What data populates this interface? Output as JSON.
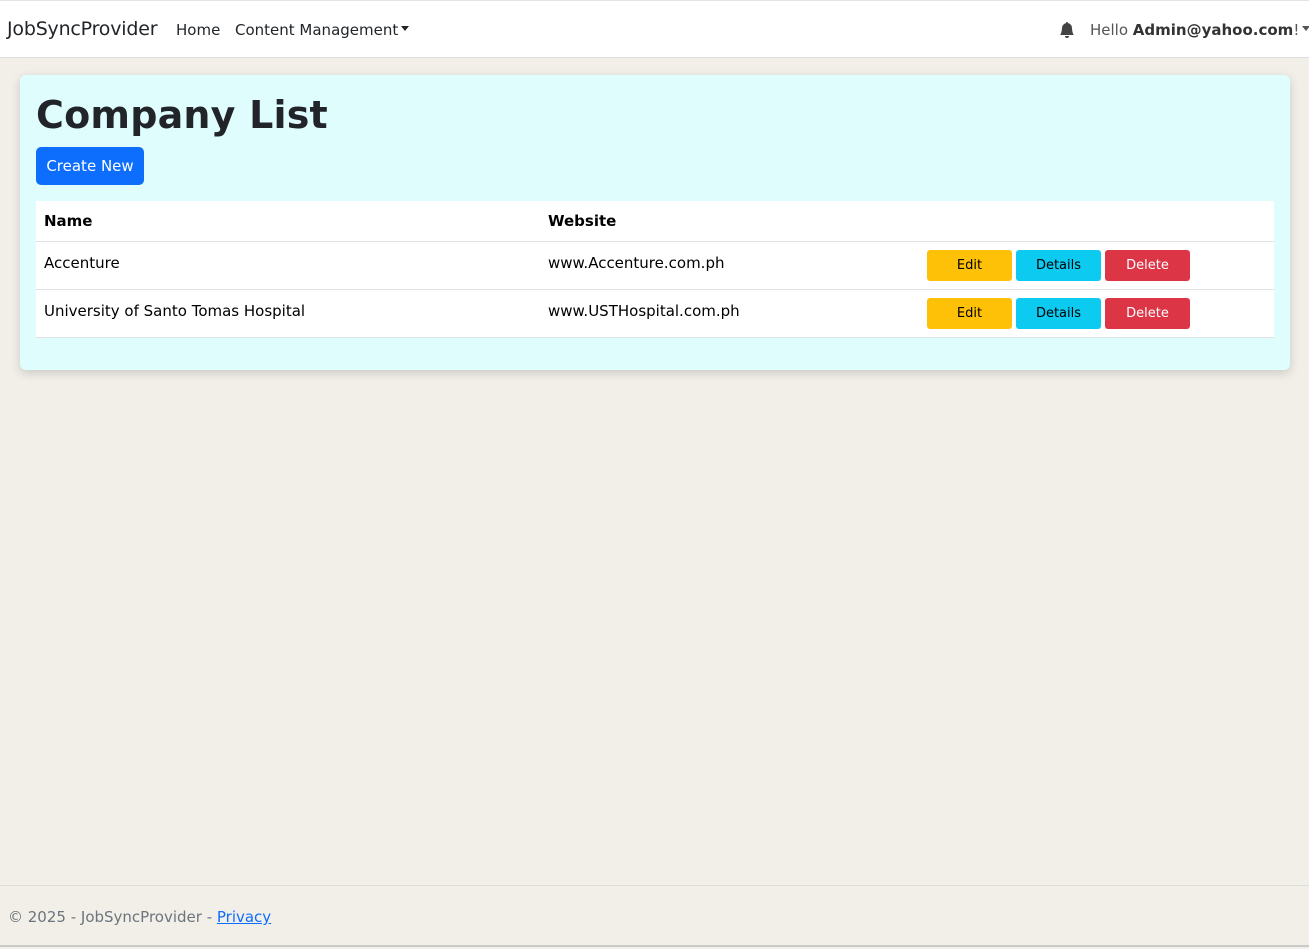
{
  "navbar": {
    "brand": "JobSyncProvider",
    "links": [
      {
        "label": "Home"
      },
      {
        "label": "Content Management"
      }
    ],
    "greeting_prefix": "Hello ",
    "user_email": "Admin@yahoo.com",
    "greeting_suffix": "!",
    "icons": {
      "notifications": "bell-icon"
    }
  },
  "main": {
    "title": "Company List",
    "create_button": "Create New",
    "table": {
      "columns": [
        "Name",
        "Website",
        ""
      ],
      "rows": [
        {
          "name": "Accenture",
          "website": "www.Accenture.com.ph"
        },
        {
          "name": "University of Santo Tomas Hospital",
          "website": "www.USTHospital.com.ph"
        }
      ],
      "actions": {
        "edit": "Edit",
        "details": "Details",
        "delete": "Delete"
      }
    }
  },
  "footer": {
    "text": "© 2025 - JobSyncProvider - ",
    "link": "Privacy"
  },
  "colors": {
    "primary": "#0d6efd",
    "warning": "#ffc107",
    "info": "#0dcaf0",
    "danger": "#dc3545",
    "card_background": "#e0fdfd",
    "page_background": "#f1efe8"
  }
}
